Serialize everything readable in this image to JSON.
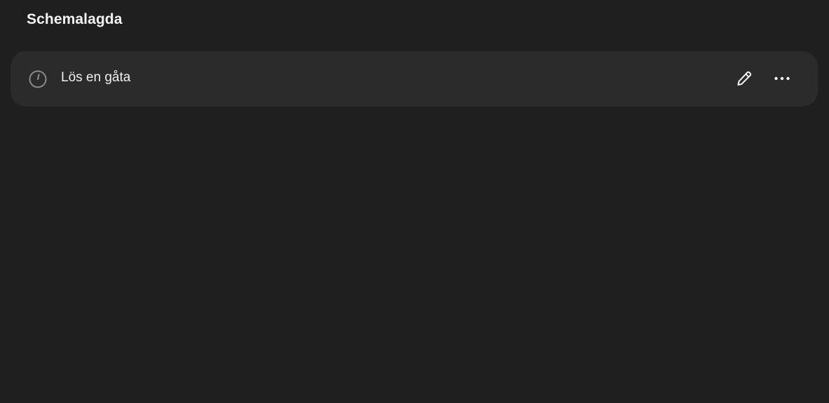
{
  "header": {
    "title": "Schemalagda"
  },
  "scheduled_tasks": [
    {
      "label": "Lös en gåta",
      "icon": "clock-icon",
      "actions": [
        "pencil-icon",
        "more-horizontal-icon"
      ]
    }
  ],
  "colors": {
    "background": "#1f1f1f",
    "row_background": "#2b2b2b",
    "text": "#f0f0f0",
    "icon_muted": "#8a8a8a"
  }
}
